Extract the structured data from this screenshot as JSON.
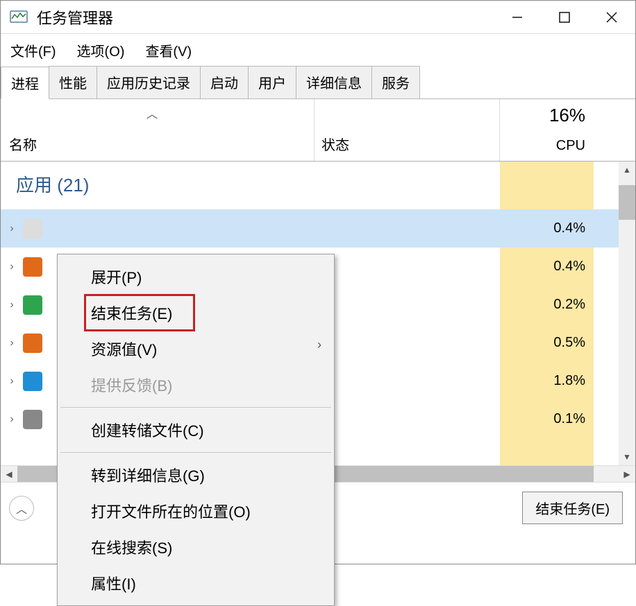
{
  "window": {
    "title": "任务管理器"
  },
  "menus": {
    "file": "文件(F)",
    "options": "选项(O)",
    "view": "查看(V)"
  },
  "tabs": [
    {
      "label": "进程",
      "active": true
    },
    {
      "label": "性能",
      "active": false
    },
    {
      "label": "应用历史记录",
      "active": false
    },
    {
      "label": "启动",
      "active": false
    },
    {
      "label": "用户",
      "active": false
    },
    {
      "label": "详细信息",
      "active": false
    },
    {
      "label": "服务",
      "active": false
    }
  ],
  "columns": {
    "name": "名称",
    "status": "状态",
    "cpu_label": "CPU",
    "cpu_value": "16%"
  },
  "group": {
    "label": "应用 (21)"
  },
  "rows": [
    {
      "cpu": "0.4%",
      "selected": true,
      "icon_color": "#dddddd"
    },
    {
      "cpu": "0.4%",
      "selected": false,
      "icon_color": "#e06a1a"
    },
    {
      "cpu": "0.2%",
      "selected": false,
      "icon_color": "#2ea44f"
    },
    {
      "cpu": "0.5%",
      "selected": false,
      "icon_color": "#e06a1a"
    },
    {
      "cpu": "1.8%",
      "selected": false,
      "icon_color": "#1f8ed6"
    },
    {
      "cpu": "0.1%",
      "selected": false,
      "icon_color": "#888888"
    }
  ],
  "context_menu": {
    "items": [
      {
        "label": "展开(P)",
        "type": "item"
      },
      {
        "label": "结束任务(E)",
        "type": "item",
        "highlighted": true
      },
      {
        "label": "资源值(V)",
        "type": "item",
        "submenu": true
      },
      {
        "label": "提供反馈(B)",
        "type": "item",
        "disabled": true
      },
      {
        "type": "sep"
      },
      {
        "label": "创建转储文件(C)",
        "type": "item"
      },
      {
        "type": "sep"
      },
      {
        "label": "转到详细信息(G)",
        "type": "item"
      },
      {
        "label": "打开文件所在的位置(O)",
        "type": "item"
      },
      {
        "label": "在线搜索(S)",
        "type": "item"
      },
      {
        "label": "属性(I)",
        "type": "item"
      }
    ]
  },
  "footer": {
    "end_task": "结束任务(E)"
  }
}
